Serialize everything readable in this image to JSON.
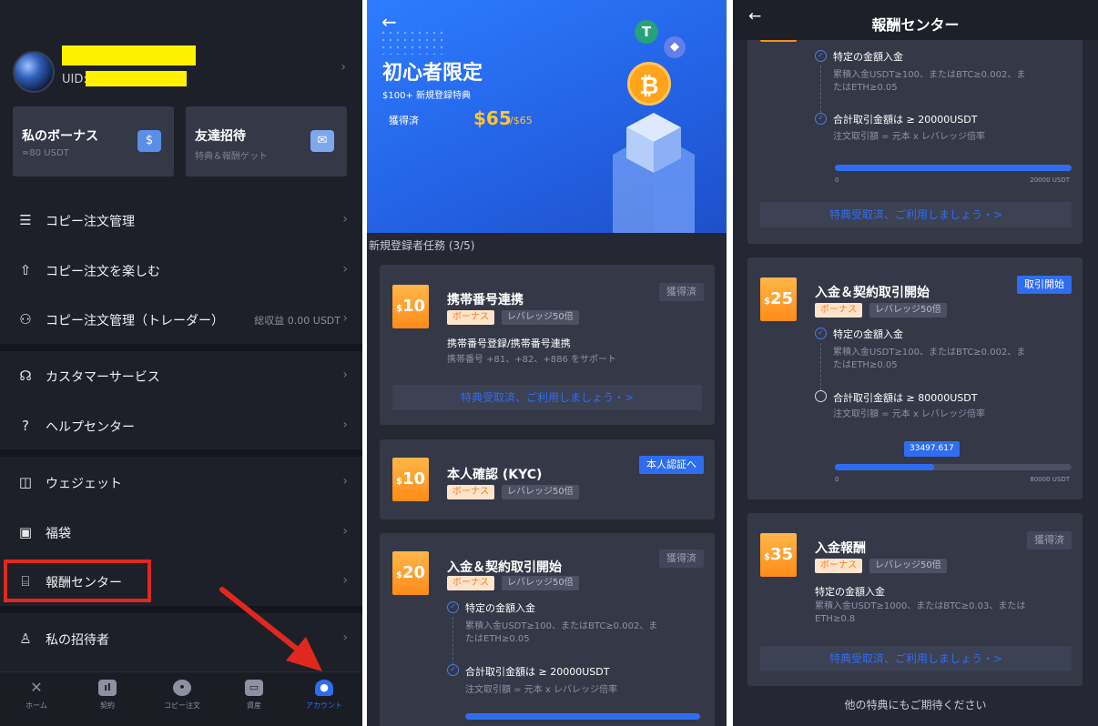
{
  "menu_panel": {
    "uid_label": "UID:",
    "bonus_card": {
      "title": "私のボーナス",
      "sub": "≈80 USDT"
    },
    "invite_card": {
      "title": "友達招待",
      "sub": "特典＆報酬ゲット"
    },
    "items": [
      {
        "label": "コピー注文管理",
        "right": ""
      },
      {
        "label": "コピー注文を楽しむ",
        "right": ""
      },
      {
        "label": "コピー注文管理（トレーダー）",
        "right": "総収益 0.00 USDT"
      },
      {
        "label": "カスタマーサービス",
        "right": ""
      },
      {
        "label": "ヘルプセンター",
        "right": ""
      },
      {
        "label": "ウェジェット",
        "right": ""
      },
      {
        "label": "福袋",
        "right": ""
      },
      {
        "label": "報酬センター",
        "right": ""
      },
      {
        "label": "私の招待者",
        "right": ""
      }
    ],
    "tabs": [
      "ホーム",
      "契約",
      "コピー注文",
      "資産",
      "アカウント"
    ]
  },
  "beginner_panel": {
    "title": "初心者限定",
    "subtitle": "$100+ 新規登録特典",
    "earned_label": "獲得済",
    "earned_value": "$65",
    "earned_max": "/$65",
    "section_title": "新規登録者任務 (3/5)",
    "task1": {
      "amount": "10",
      "title": "携帯番号連携",
      "tag_bonus": "ボーナス",
      "tag_leverage": "レバレッジ50倍",
      "status": "獲得済",
      "desc": "携帯番号登録/携帯番号連携",
      "note": "携帯番号 +81、+82、+886 をサポート",
      "cta": "特典受取済、ご利用しましょう・>"
    },
    "task2": {
      "amount": "10",
      "title": "本人確認 (KYC)",
      "tag_bonus": "ボーナス",
      "tag_leverage": "レバレッジ50倍",
      "status": "本人認証へ"
    },
    "task3": {
      "amount": "20",
      "title": "入金＆契約取引開始",
      "tag_bonus": "ボーナス",
      "tag_leverage": "レバレッジ50倍",
      "status": "獲得済",
      "step1": "特定の金額入金",
      "step1_note": "累積入金USDT≥100、またはBTC≥0.002、ま\nたはETH≥0.05",
      "step2": "合計取引金額は ≥ 20000USDT",
      "step2_note": "注文取引額 = 元本 x レバレッジ倍率"
    }
  },
  "reward_panel": {
    "title": "報酬センター",
    "top_step1": "特定の金額入金",
    "top_step1_note": "累積入金USDT≥100、またはBTC≥0.002、ま\nたはETH≥0.05",
    "top_step2": "合計取引金額は ≥ 20000USDT",
    "top_step2_note": "注文取引額 = 元本 x レバレッジ倍率",
    "top_bar_min": "0",
    "top_bar_max": "20000 USDT",
    "top_bar_fraction": 1.0,
    "top_cta": "特典受取済、ご利用しましょう・>",
    "task25": {
      "amount": "25",
      "title": "入金＆契約取引開始",
      "tag_bonus": "ボーナス",
      "tag_leverage": "レバレッジ50倍",
      "status": "取引開始",
      "step1": "特定の金額入金",
      "step1_note": "累積入金USDT≥100、またはBTC≥0.002、ま\nたはETH≥0.05",
      "step2": "合計取引金額は ≥ 80000USDT",
      "step2_note": "注文取引額 = 元本 x レバレッジ倍率",
      "progress_value": "33497.617",
      "progress_fraction": 0.419,
      "bar_min": "0",
      "bar_max": "80000 USDT"
    },
    "task35": {
      "amount": "35",
      "title": "入金報酬",
      "tag_bonus": "ボーナス",
      "tag_leverage": "レバレッジ50倍",
      "status": "獲得済",
      "desc": "特定の金額入金",
      "note": "累積入金USDT≥1000、またはBTC≥0.03、または\nETH≥0.8",
      "cta": "特典受取済、ご利用しましょう・>"
    },
    "footer": "他の特典にもご期待ください"
  },
  "colors": {
    "accent": "#2f6df0",
    "orange": "#ff9a2e",
    "highlight": "#fff100",
    "annotation_red": "#e0281f"
  }
}
